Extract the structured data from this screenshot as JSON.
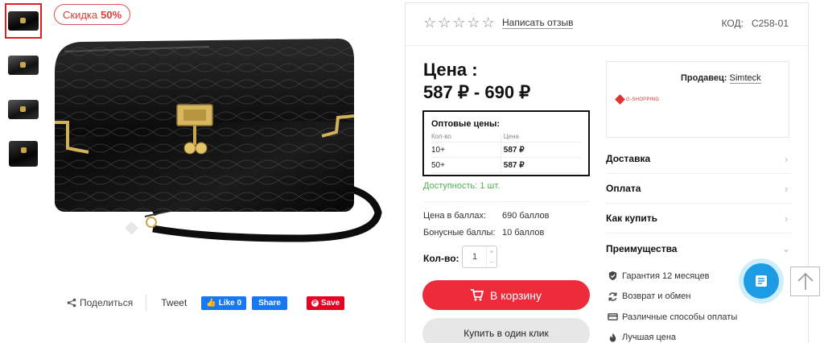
{
  "gallery": {
    "discount_label": "Скидка",
    "discount_value": "50%",
    "thumbnail_count": 4
  },
  "share": {
    "share_label": "Поделиться",
    "tweet_label": "Tweet",
    "fb_like_label": "Like 0",
    "fb_share_label": "Share",
    "pinterest_label": "Save"
  },
  "product": {
    "rating": 0,
    "review_link": "Написать отзыв",
    "code_label": "КОД:",
    "code_value": "C258-01",
    "price_label": "Цена :",
    "price_range": "587 ₽ - 690 ₽",
    "availability": "Доступность: 1 шт.",
    "points_label": "Цена в баллах:",
    "points_value": "690 баллов",
    "bonus_label": "Бонусные баллы:",
    "bonus_value": "10 баллов",
    "qty_label": "Кол-во:",
    "qty_value": "1",
    "cart_button": "В корзину",
    "buy_one_click": "Купить в один клик"
  },
  "wholesale": {
    "title": "Оптовые цены:",
    "col_qty": "Кол-во",
    "col_price": "Цена",
    "rows": [
      {
        "qty": "10+",
        "price": "587 ₽"
      },
      {
        "qty": "50+",
        "price": "587 ₽"
      }
    ]
  },
  "seller": {
    "label": "Продавец:",
    "name": "Simteck",
    "logo_text": "G-SHOPPING"
  },
  "accordion": [
    {
      "label": "Доставка",
      "open": false
    },
    {
      "label": "Оплата",
      "open": false
    },
    {
      "label": "Как купить",
      "open": false
    },
    {
      "label": "Преимущества",
      "open": true
    }
  ],
  "benefits": [
    {
      "icon": "shield-check-icon",
      "label": "Гарантия 12 месяцев"
    },
    {
      "icon": "refresh-icon",
      "label": "Возврат и обмен"
    },
    {
      "icon": "credit-card-icon",
      "label": "Различные способы оплаты"
    },
    {
      "icon": "flame-icon",
      "label": "Лучшая цена"
    }
  ],
  "colors": {
    "accent_red": "#ed2b3b",
    "availability_green": "#4caf50",
    "fab_blue": "#1e9be5",
    "facebook_blue": "#1877f2",
    "pinterest_red": "#e60023"
  }
}
